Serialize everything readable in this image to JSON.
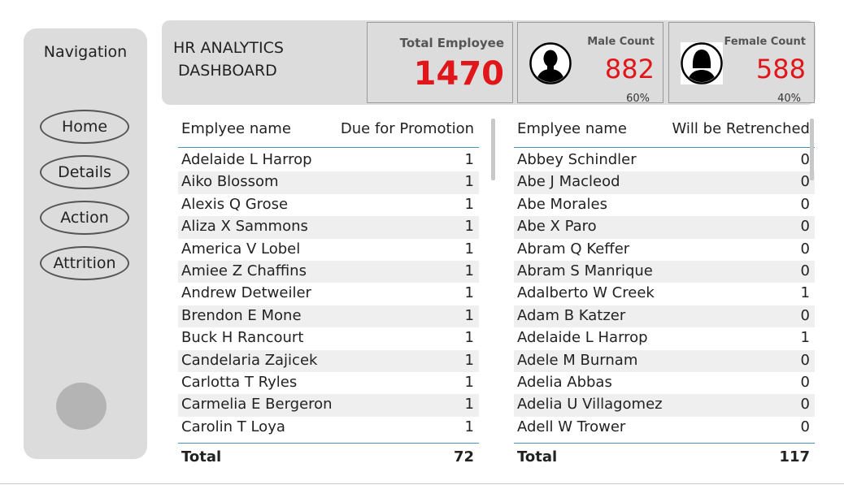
{
  "nav": {
    "title": "Navigation",
    "buttons": [
      "Home",
      "Details",
      "Action",
      "Attrition"
    ]
  },
  "header": {
    "title_line1": "HR ANALYTICS",
    "title_line2": "DASHBOARD"
  },
  "kpi": {
    "total": {
      "label": "Total Employee",
      "value": "1470"
    },
    "male": {
      "label": "Male Count",
      "value": "882",
      "pct": "60%"
    },
    "female": {
      "label": "Female Count",
      "value": "588",
      "pct": "40%"
    },
    "value_color": "#e0161b"
  },
  "promotion_table": {
    "col1": "Emplyee name",
    "col2": "Due for Promotion",
    "rows": [
      [
        "Adelaide L Harrop",
        "1"
      ],
      [
        "Aiko Blossom",
        "1"
      ],
      [
        "Alexis Q Grose",
        "1"
      ],
      [
        "Aliza X Sammons",
        "1"
      ],
      [
        "America V Lobel",
        "1"
      ],
      [
        "Amiee Z Chaffins",
        "1"
      ],
      [
        "Andrew Detweiler",
        "1"
      ],
      [
        "Brendon E Mone",
        "1"
      ],
      [
        "Buck H Rancourt",
        "1"
      ],
      [
        "Candelaria Zajicek",
        "1"
      ],
      [
        "Carlotta T Ryles",
        "1"
      ],
      [
        "Carmelia E Bergeron",
        "1"
      ],
      [
        "Carolin T Loya",
        "1"
      ]
    ],
    "total_label": "Total",
    "total_value": "72"
  },
  "retrench_table": {
    "col1": "Emplyee name",
    "col2": "Will be Retrenched",
    "rows": [
      [
        "Abbey Schindler",
        "0"
      ],
      [
        "Abe J Macleod",
        "0"
      ],
      [
        "Abe Morales",
        "0"
      ],
      [
        "Abe X Paro",
        "0"
      ],
      [
        "Abram Q Keffer",
        "0"
      ],
      [
        "Abram S Manrique",
        "0"
      ],
      [
        "Adalberto W Creek",
        "1"
      ],
      [
        "Adam B Katzer",
        "0"
      ],
      [
        "Adelaide L Harrop",
        "1"
      ],
      [
        "Adele M Burnam",
        "0"
      ],
      [
        "Adelia Abbas",
        "0"
      ],
      [
        "Adelia U Villagomez",
        "0"
      ],
      [
        "Adell W Trower",
        "0"
      ]
    ],
    "total_label": "Total",
    "total_value": "117"
  }
}
